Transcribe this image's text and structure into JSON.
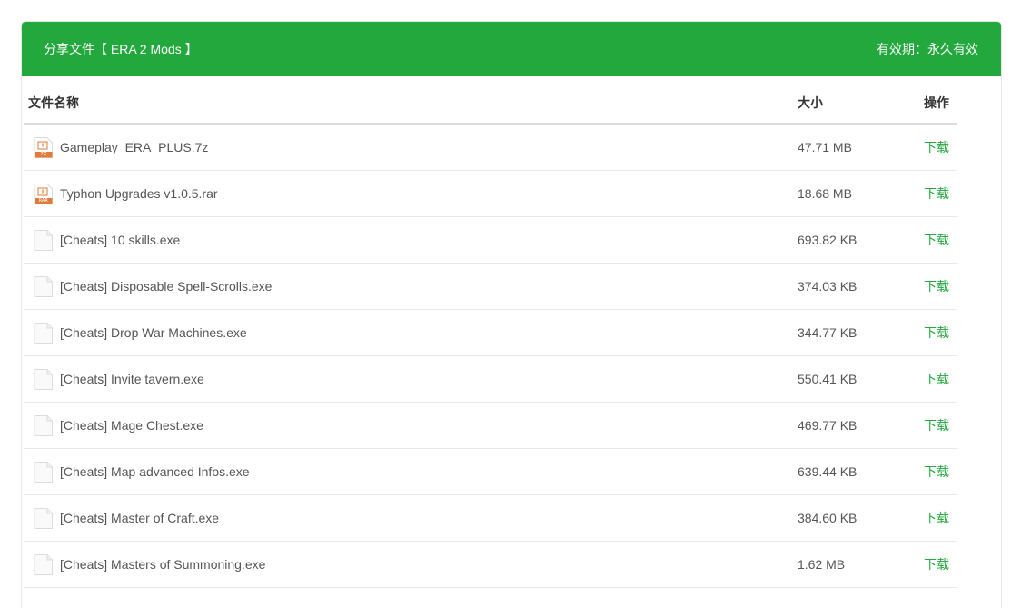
{
  "header": {
    "title": "分享文件【 ERA 2 Mods 】",
    "expiry": "有效期：永久有效"
  },
  "table": {
    "columns": {
      "name": "文件名称",
      "size": "大小",
      "action": "操作"
    },
    "rows": [
      {
        "name": "Gameplay_ERA_PLUS.7z",
        "size": "47.71 MB",
        "action": "下载",
        "icon": "archive-7z-icon",
        "badge": "7Z"
      },
      {
        "name": "Typhon Upgrades v1.0.5.rar",
        "size": "18.68 MB",
        "action": "下载",
        "icon": "archive-rar-icon",
        "badge": "RAR"
      },
      {
        "name": "[Cheats] 10 skills.exe",
        "size": "693.82 KB",
        "action": "下载",
        "icon": "file-icon"
      },
      {
        "name": "[Cheats] Disposable Spell-Scrolls.exe",
        "size": "374.03 KB",
        "action": "下载",
        "icon": "file-icon"
      },
      {
        "name": "[Cheats] Drop War Machines.exe",
        "size": "344.77 KB",
        "action": "下载",
        "icon": "file-icon"
      },
      {
        "name": "[Cheats] Invite tavern.exe",
        "size": "550.41 KB",
        "action": "下载",
        "icon": "file-icon"
      },
      {
        "name": "[Cheats] Mage Chest.exe",
        "size": "469.77 KB",
        "action": "下载",
        "icon": "file-icon"
      },
      {
        "name": "[Cheats] Map advanced Infos.exe",
        "size": "639.44 KB",
        "action": "下载",
        "icon": "file-icon"
      },
      {
        "name": "[Cheats] Master of Craft.exe",
        "size": "384.60 KB",
        "action": "下载",
        "icon": "file-icon"
      },
      {
        "name": "[Cheats] Masters of Summoning.exe",
        "size": "1.62 MB",
        "action": "下载",
        "icon": "file-icon"
      }
    ]
  },
  "colors": {
    "header_bg": "#22a83d",
    "link": "#22a83d",
    "archive_icon": "#e07b39"
  }
}
